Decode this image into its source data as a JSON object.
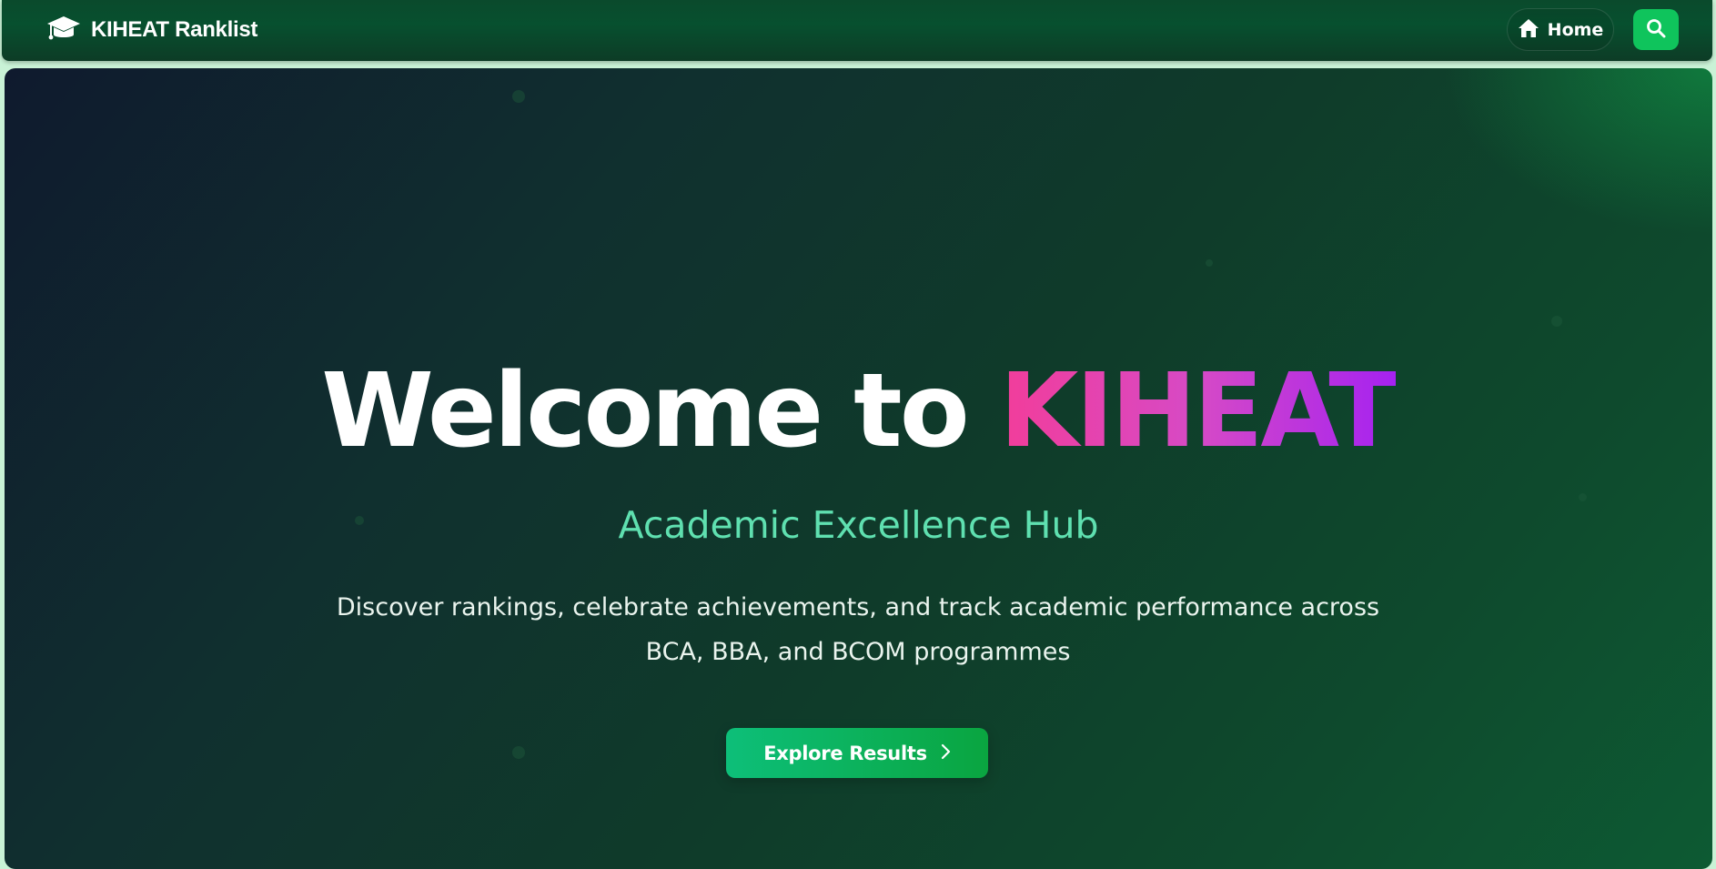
{
  "navbar": {
    "brand_icon": "graduation-cap-icon",
    "brand_title": "KIHEAT Ranklist",
    "home_label": "Home",
    "home_icon": "home-icon",
    "search_icon": "search-icon"
  },
  "hero": {
    "title_prefix": "Welcome to ",
    "title_accent": "KIHEAT",
    "subtitle": "Academic Excellence Hub",
    "description": "Discover rankings, celebrate achievements, and track academic performance across BCA, BBA, and BCOM programmes",
    "cta_label": "Explore Results",
    "cta_icon": "chevron-right-icon"
  },
  "colors": {
    "accent_green": "#0fc45c",
    "subtitle_teal": "#5fe0b0",
    "title_gradient_start": "#f23d9a",
    "title_gradient_end": "#a522f0"
  }
}
